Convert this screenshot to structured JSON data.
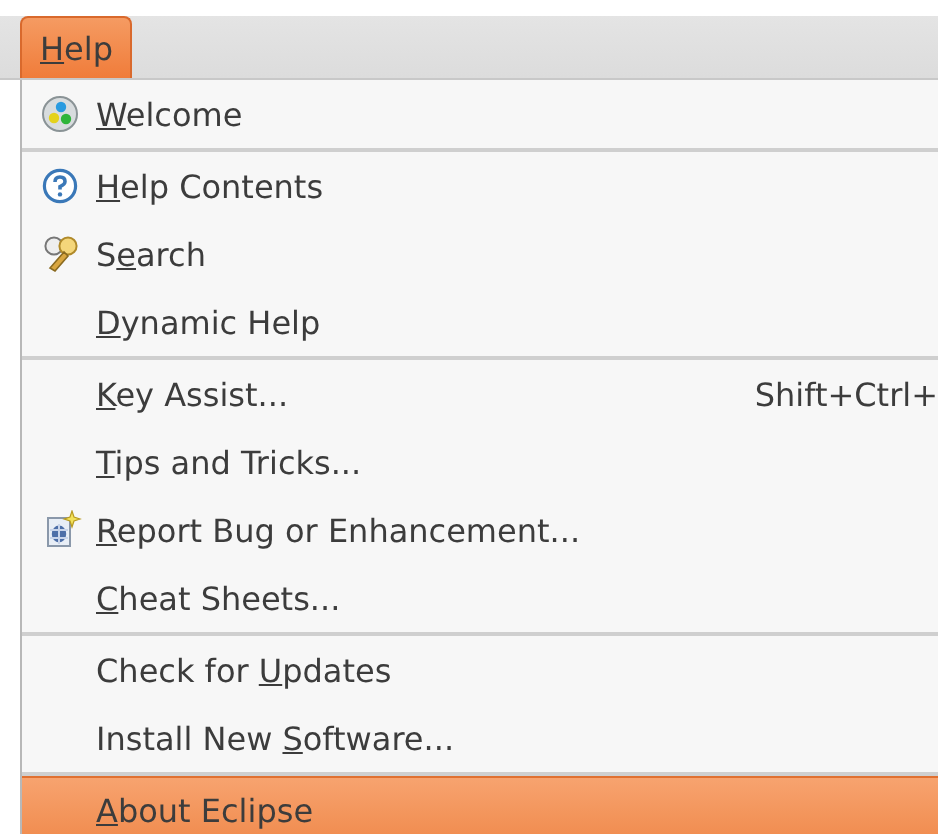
{
  "menubar": [
    {
      "label": {
        "key": "H",
        "post": "elp"
      },
      "selected": true
    }
  ],
  "menu": {
    "groups": [
      [
        {
          "kind": "welcome",
          "label": {
            "key": "W",
            "post": "elcome"
          },
          "selected": false
        }
      ],
      [
        {
          "kind": "help",
          "label": {
            "key": "H",
            "post": "elp Contents"
          },
          "selected": false
        },
        {
          "kind": "search",
          "label": {
            "pre": "S",
            "key": "e",
            "post": "arch"
          },
          "selected": false
        },
        {
          "kind": "plain",
          "label": {
            "key": "D",
            "post": "ynamic Help"
          },
          "selected": false
        }
      ],
      [
        {
          "kind": "plain",
          "label": {
            "key": "K",
            "post": "ey Assist..."
          },
          "shortcut": "Shift+Ctrl+",
          "selected": false
        },
        {
          "kind": "plain",
          "label": {
            "key": "T",
            "post": "ips and Tricks..."
          },
          "selected": false
        },
        {
          "kind": "bug",
          "label": {
            "key": "R",
            "post": "eport Bug or Enhancement..."
          },
          "selected": false
        },
        {
          "kind": "plain",
          "label": {
            "key": "C",
            "post": "heat Sheets..."
          },
          "selected": false
        }
      ],
      [
        {
          "kind": "plain",
          "label": {
            "pre": "Check for ",
            "key": "U",
            "post": "pdates"
          },
          "selected": false
        },
        {
          "kind": "plain",
          "label": {
            "pre": "Install New ",
            "key": "S",
            "post": "oftware..."
          },
          "selected": false
        }
      ],
      [
        {
          "kind": "plain",
          "label": {
            "key": "A",
            "post": "bout Eclipse"
          },
          "selected": true
        }
      ]
    ]
  }
}
